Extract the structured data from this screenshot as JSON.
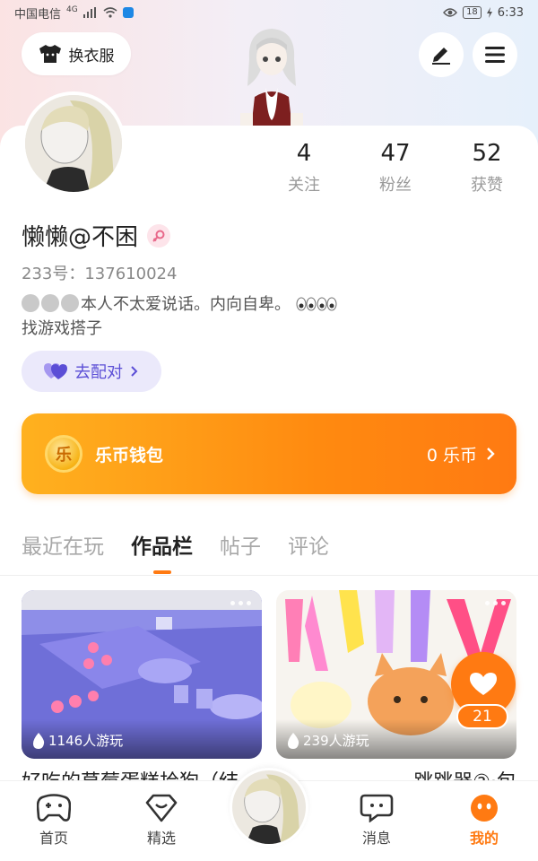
{
  "status_bar": {
    "carrier": "中国电信",
    "network": "4G",
    "battery": "18",
    "time": "6:33"
  },
  "header": {
    "dress_up_label": "换衣服",
    "icons": {
      "dress": "tshirt-icon",
      "edit": "pen-icon",
      "menu": "hamburger-menu-icon"
    }
  },
  "stats": [
    {
      "value": "4",
      "label": "关注"
    },
    {
      "value": "47",
      "label": "粉丝"
    },
    {
      "value": "52",
      "label": "获赞"
    }
  ],
  "profile": {
    "username": "懒懒@不困",
    "uid": "233号：137610024",
    "bio_line1": "本人不太爱说话。内向自卑。",
    "bio_line2": "找游戏搭子"
  },
  "match_button": {
    "label": "去配对"
  },
  "wallet": {
    "coin_glyph": "乐",
    "label": "乐币钱包",
    "balance": "0 乐币"
  },
  "tabs": [
    {
      "label": "最近在玩",
      "active": false
    },
    {
      "label": "作品栏",
      "active": true
    },
    {
      "label": "帖子",
      "active": false
    },
    {
      "label": "评论",
      "active": false
    }
  ],
  "games": [
    {
      "plays": "1146人游玩"
    },
    {
      "plays": "239人游玩"
    }
  ],
  "like": {
    "count": "21"
  },
  "titles_peek": {
    "left": "好吃的草莓蛋糕拾狗（结",
    "right": "跳跳器②·包"
  },
  "bottom_nav": [
    {
      "label": "首页",
      "icon": "gamepad-icon"
    },
    {
      "label": "精选",
      "icon": "heart-diamond-icon"
    },
    {
      "label": "消息",
      "icon": "chat-bubble-icon"
    },
    {
      "label": "我的",
      "icon": "face-icon",
      "active": true
    }
  ],
  "colors": {
    "accent": "#ff7a12",
    "match_bg": "#ebe9fb",
    "match_text": "#5b4ed6"
  }
}
